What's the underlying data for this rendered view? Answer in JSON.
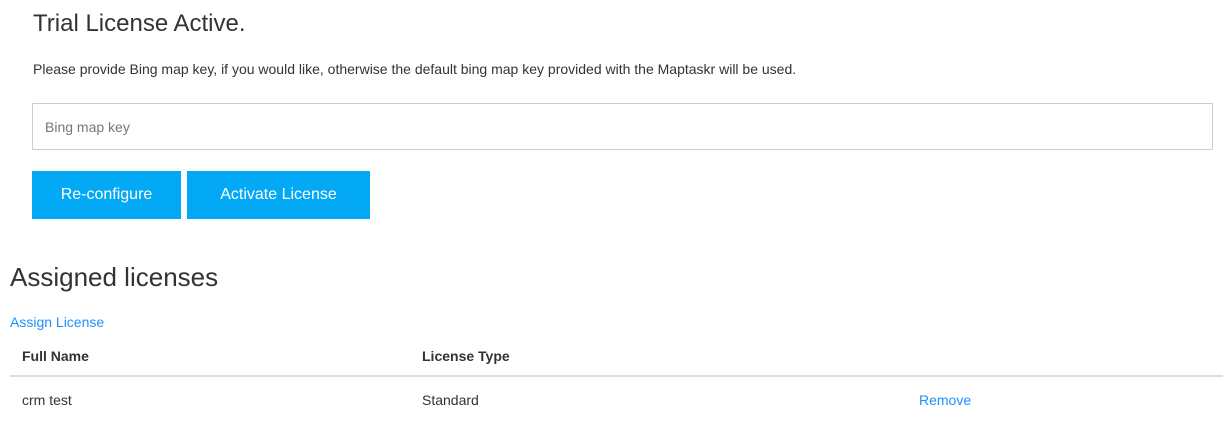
{
  "trial": {
    "title": "Trial License Active.",
    "description": "Please provide Bing map key, if you would like, otherwise the default bing map key provided with the Maptaskr will be used.",
    "bing_key_placeholder": "Bing map key",
    "bing_key_value": ""
  },
  "buttons": {
    "reconfigure_label": "Re-configure",
    "activate_label": "Activate License"
  },
  "assigned": {
    "title": "Assigned licenses",
    "assign_link": "Assign License",
    "columns": [
      "Full Name",
      "License Type",
      ""
    ],
    "rows": [
      {
        "full_name": "crm test",
        "license_type": "Standard",
        "action": "Remove"
      }
    ]
  },
  "colors": {
    "accent_button": "#03a9f4",
    "link": "#1e90ff",
    "text": "#333333",
    "border": "#cccccc"
  }
}
